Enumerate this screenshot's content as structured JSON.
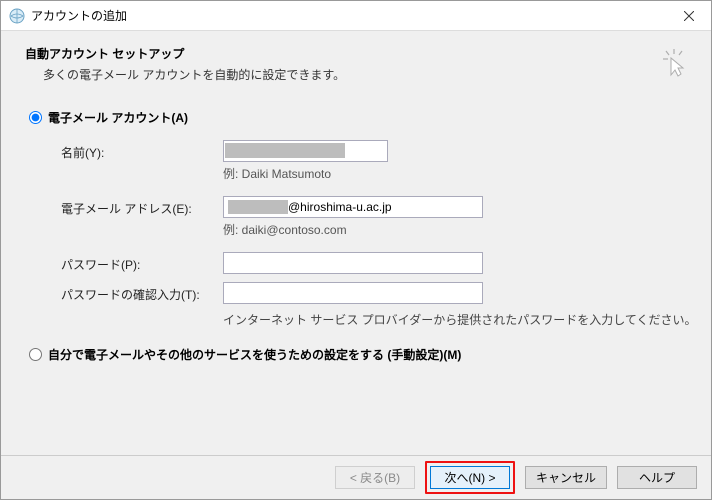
{
  "window": {
    "title": "アカウントの追加"
  },
  "header": {
    "title": "自動アカウント セットアップ",
    "subtitle": "多くの電子メール アカウントを自動的に設定できます。"
  },
  "radios": {
    "email_account": "電子メール アカウント(A)",
    "manual_setup": "自分で電子メールやその他のサービスを使うための設定をする (手動設定)(M)"
  },
  "fields": {
    "name": {
      "label": "名前(Y):",
      "value": "",
      "example": "例: Daiki Matsumoto"
    },
    "email": {
      "label": "電子メール アドレス(E):",
      "domain_suffix": "@hiroshima-u.ac.jp",
      "example": "例: daiki@contoso.com"
    },
    "password": {
      "label": "パスワード(P):",
      "value": ""
    },
    "password_confirm": {
      "label": "パスワードの確認入力(T):",
      "value": ""
    },
    "password_hint": "インターネット サービス プロバイダーから提供されたパスワードを入力してください。"
  },
  "buttons": {
    "back": "< 戻る(B)",
    "next": "次へ(N) >",
    "cancel": "キャンセル",
    "help": "ヘルプ"
  }
}
